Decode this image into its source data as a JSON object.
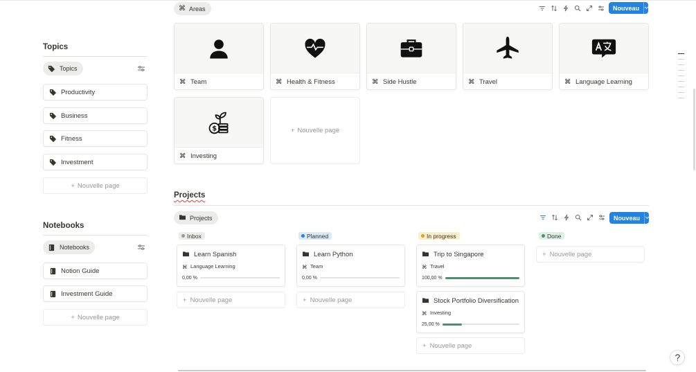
{
  "left": {
    "topics": {
      "title": "Topics",
      "chip": "Topics",
      "items": [
        "Productivity",
        "Business",
        "Fitness",
        "Investment"
      ],
      "new_page": "Nouvelle page"
    },
    "notebooks": {
      "title": "Notebooks",
      "chip": "Notebooks",
      "items": [
        "Notion Guide",
        "Investment Guide"
      ],
      "new_page": "Nouvelle page"
    }
  },
  "areas": {
    "view_chip": "Areas",
    "new_button": "Nouveau",
    "cards": [
      {
        "title": "Team",
        "icon": "person-icon"
      },
      {
        "title": "Health & Fitness",
        "icon": "heart-pulse-icon"
      },
      {
        "title": "Side Hustle",
        "icon": "briefcase-icon"
      },
      {
        "title": "Travel",
        "icon": "airplane-icon"
      },
      {
        "title": "Language Learning",
        "icon": "translate-icon"
      },
      {
        "title": "Investing",
        "icon": "plant-coins-icon"
      }
    ],
    "new_page": "Nouvelle page"
  },
  "projects": {
    "heading": "Projects",
    "view_chip": "Projects",
    "new_button": "Nouveau",
    "columns": [
      {
        "status": "Inbox",
        "dot": "#9b9a97",
        "bg": "#ececea",
        "cards": [
          {
            "title": "Learn Spanish",
            "tag": "Language Learning",
            "progress": "0,00 %",
            "fraction": 0
          }
        ],
        "new_page": "Nouvelle page"
      },
      {
        "status": "Planned",
        "dot": "#2383e2",
        "bg": "#dbe8f7",
        "cards": [
          {
            "title": "Learn Python",
            "tag": "Team",
            "progress": "0,00 %",
            "fraction": 0
          }
        ],
        "new_page": "Nouvelle page"
      },
      {
        "status": "In progress",
        "dot": "#d9a22b",
        "bg": "#fbeecb",
        "cards": [
          {
            "title": "Trip to Singapore",
            "tag": "Travel",
            "progress": "100,00 %",
            "fraction": 1
          },
          {
            "title": "Stock Portfolio Diversification",
            "tag": "Investing",
            "progress": "25,00 %",
            "fraction": 0.25
          }
        ],
        "new_page": "Nouvelle page"
      },
      {
        "status": "Done",
        "dot": "#4e8f74",
        "bg": "#dff0e7",
        "cards": [],
        "new_page": "Nouvelle page"
      }
    ]
  },
  "colors": {
    "accent": "#2383e2",
    "progress": "#4e8f74"
  }
}
